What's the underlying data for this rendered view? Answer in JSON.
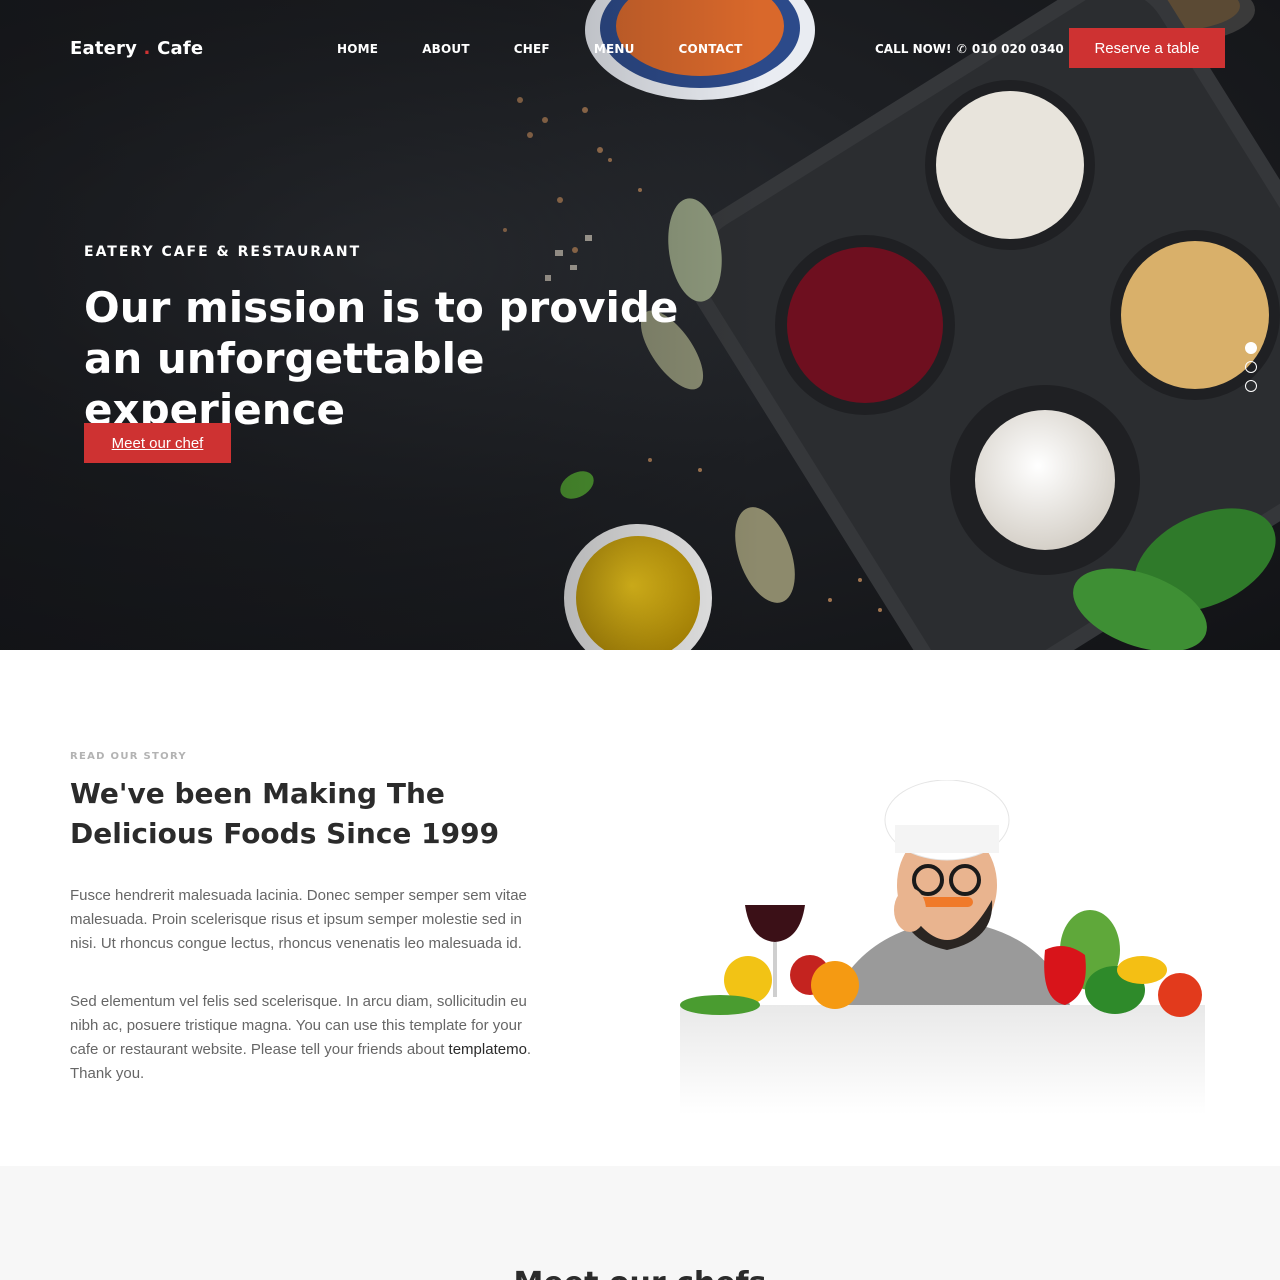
{
  "header": {
    "brand_left": "Eatery",
    "brand_dot": ".",
    "brand_right": "Cafe",
    "nav": [
      "HOME",
      "ABOUT",
      "CHEF",
      "MENU",
      "CONTACT"
    ],
    "call_label": "CALL NOW!",
    "phone": "010 020 0340",
    "phone_icon": "phone-icon",
    "reserve_label": "Reserve a table"
  },
  "hero": {
    "eyebrow": "EATERY CAFE & RESTAURANT",
    "headline": "Our mission is to provide an unforgettable experience",
    "cta_label": "Meet our chef",
    "slides_total": 3,
    "active_slide": 1
  },
  "story": {
    "label": "READ OUR STORY",
    "title": "We've been Making The Delicious Foods Since 1999",
    "p1": "Fusce hendrerit malesuada lacinia. Donec semper semper sem vitae malesuada. Proin scelerisque risus et ipsum semper molestie sed in nisi. Ut rhoncus congue lectus, rhoncus venenatis leo malesuada id.",
    "p2_before": "Sed elementum vel felis sed scelerisque. In arcu diam, sollicitudin eu nibh ac, posuere tristique magna. You can use this template for your cafe or restaurant website. Please tell your friends about ",
    "p2_link": "templatemo",
    "p2_after": ". Thank you."
  },
  "next_section": {
    "title": "Meet our chefs"
  },
  "colors": {
    "accent": "#ce3232",
    "hero_bg": "#1d1f23",
    "section_bg": "#f7f7f7"
  }
}
